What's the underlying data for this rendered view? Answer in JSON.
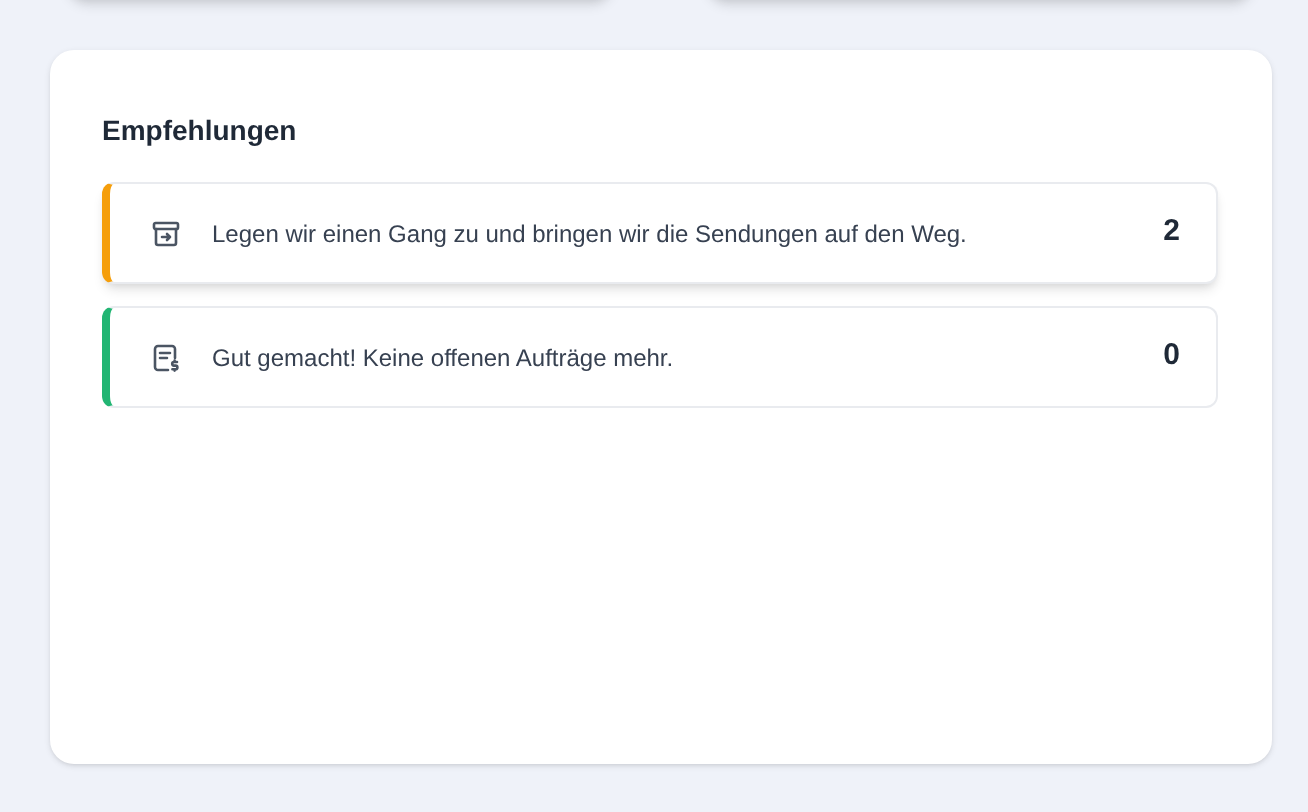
{
  "recommendations": {
    "title": "Empfehlungen",
    "items": [
      {
        "kind": "archive",
        "color": "#f59e0b",
        "text": "Legen wir einen Gang zu und bringen wir die Sendungen auf den Weg.",
        "count": "2"
      },
      {
        "kind": "invoice",
        "color": "#22b573",
        "text": "Gut gemacht! Keine offenen Aufträge mehr.",
        "count": "0"
      }
    ]
  }
}
